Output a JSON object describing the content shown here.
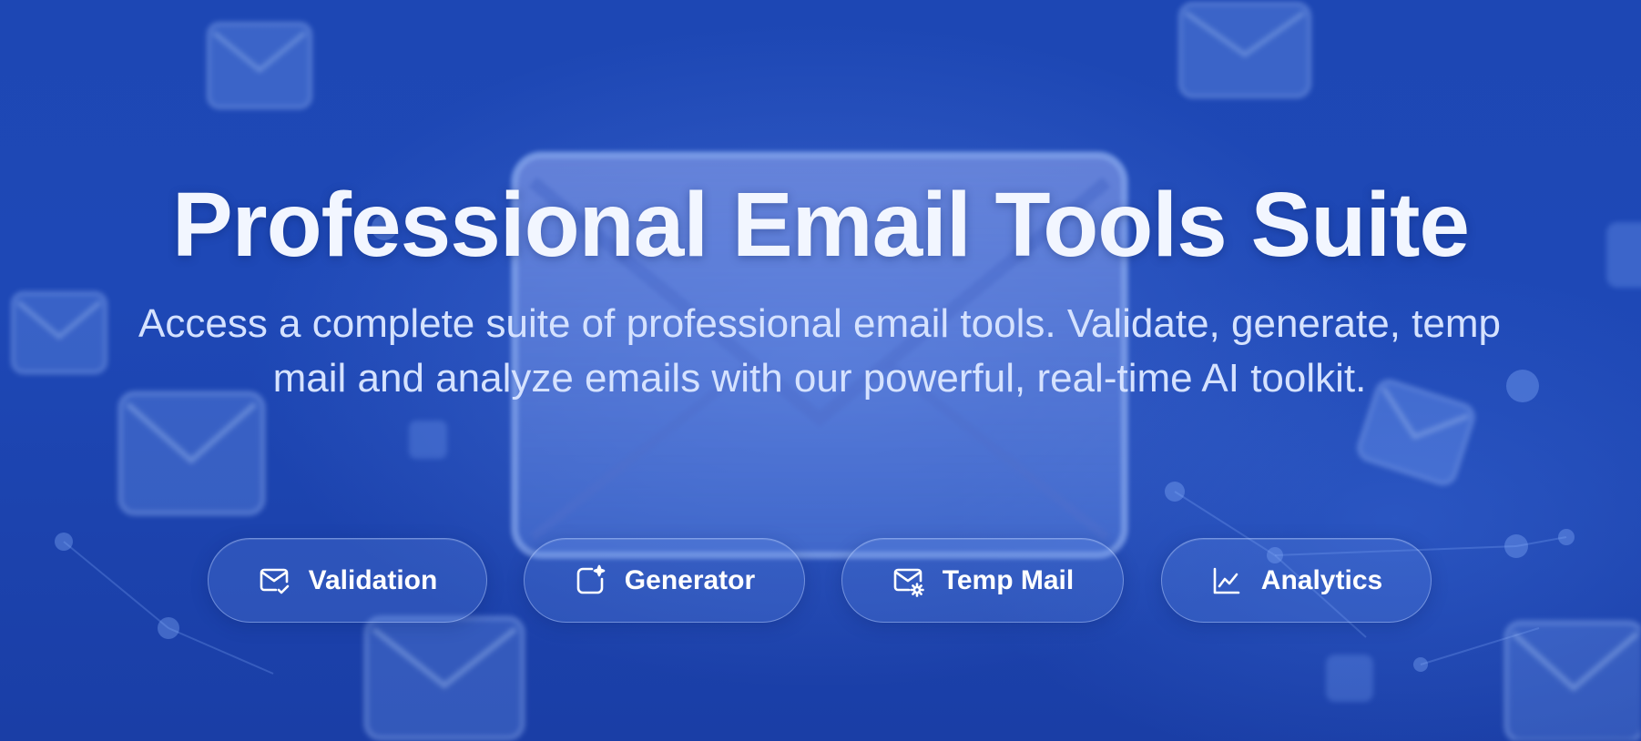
{
  "hero": {
    "title": "Professional Email Tools Suite",
    "subtitle": "Access a complete suite of professional email tools. Validate, generate, temp mail and analyze emails with our powerful, real-time AI toolkit."
  },
  "tools": [
    {
      "label": "Validation",
      "icon": "mail-check-icon"
    },
    {
      "label": "Generator",
      "icon": "sparkle-square-icon"
    },
    {
      "label": "Temp Mail",
      "icon": "mail-gear-icon"
    },
    {
      "label": "Analytics",
      "icon": "line-chart-icon"
    }
  ],
  "colors": {
    "background": "#1d47b4",
    "title": "#f2f6ff",
    "subtitle": "#d5e2ff",
    "button_text": "#ffffff"
  }
}
